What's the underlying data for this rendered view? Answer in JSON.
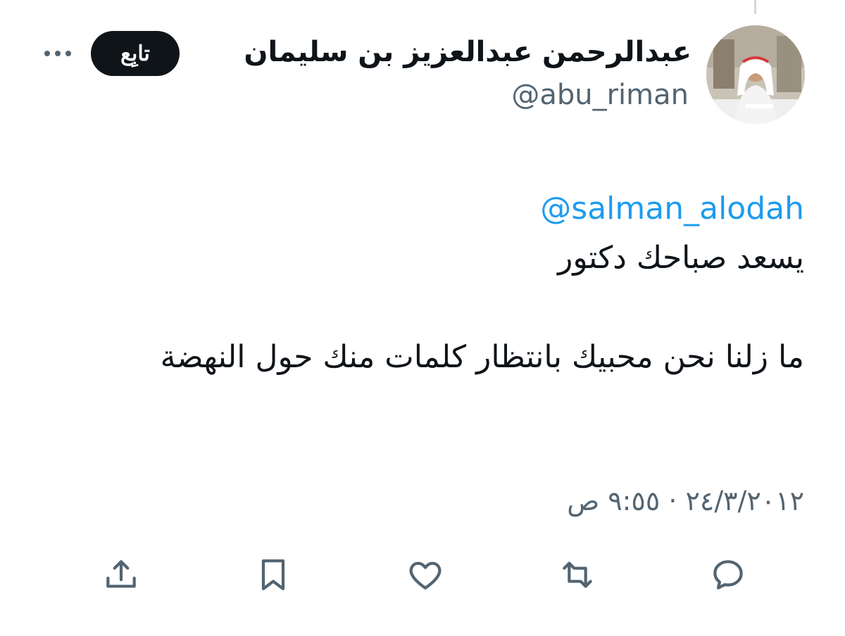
{
  "author": {
    "display_name": "عبدالرحمن عبدالعزيز بن سليمان",
    "handle": "@abu_riman"
  },
  "follow_button_label": "تابِع",
  "tweet": {
    "mention": "@salman_alodah",
    "line1": "يسعد صباحك دكتور",
    "line2": "ما زلنا نحن محبيك بانتظار كلمات منك حول النهضة",
    "timestamp": "٢٤/٣/٢٠١٢ · ٩:٥٥ ص"
  },
  "actions": [
    "reply-icon",
    "retweet-icon",
    "like-icon",
    "bookmark-icon",
    "share-icon"
  ],
  "colors": {
    "text": "#0f1419",
    "secondary": "#536471",
    "link": "#1d9bf0",
    "button_bg": "#0f1419",
    "icon": "#536471"
  }
}
